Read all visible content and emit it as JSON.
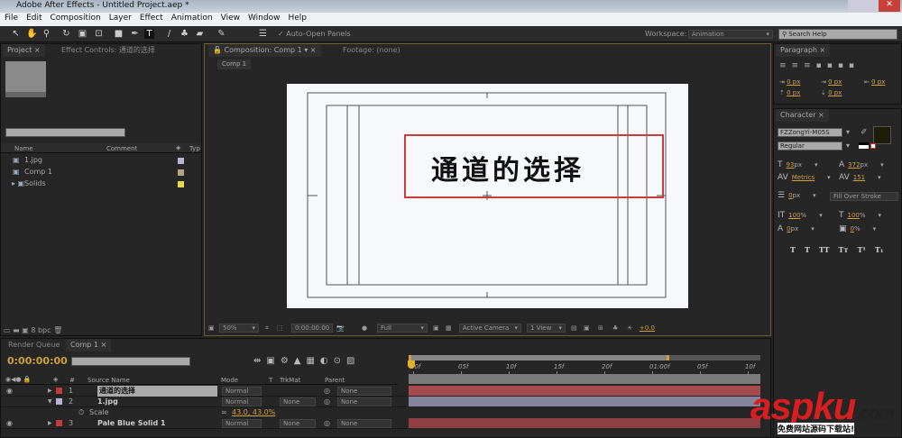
{
  "window": {
    "title": "Adobe After Effects - Untitled Project.aep *"
  },
  "menu": [
    "File",
    "Edit",
    "Composition",
    "Layer",
    "Effect",
    "Animation",
    "View",
    "Window",
    "Help"
  ],
  "toolbar": {
    "auto_open": "Auto-Open Panels",
    "workspace_label": "Workspace:",
    "workspace": "Animation",
    "search_placeholder": "Search Help"
  },
  "project": {
    "tab": "Project",
    "effect_tab": "Effect Controls: 通道的选择",
    "columns": [
      "Name",
      "Comment",
      "Typ"
    ],
    "items": [
      {
        "name": "1.jpg",
        "color": "#b9b3d9"
      },
      {
        "name": "Comp 1",
        "color": "#b6a483"
      },
      {
        "name": "Solids",
        "color": "#e6d94e"
      }
    ],
    "bpc": "8 bpc"
  },
  "comp": {
    "tab": "Composition: Comp 1",
    "footage_tab": "Footage: (none)",
    "breadcrumb": "Comp 1",
    "text": "通道的选择",
    "footer": {
      "zoom": "50%",
      "time": "0:00:00:00",
      "resolution": "Full",
      "camera": "Active Camera",
      "views": "1 View",
      "exposure": "+0.0"
    }
  },
  "paragraph": {
    "tab": "Paragraph",
    "values": [
      "0 px",
      "0 px",
      "0 px",
      "0 px",
      "0 px"
    ]
  },
  "character": {
    "tab": "Character",
    "font": "FZZongYi-M05S",
    "style": "Regular",
    "size": "93",
    "size_unit": "px",
    "leading": "372",
    "leading_unit": "px",
    "kerning": "Metrics",
    "tracking": "151",
    "stroke": "0",
    "stroke_unit": "px",
    "stroke_mode": "Fill Over Stroke",
    "vscale": "100",
    "hscale": "100",
    "baseline": "0",
    "baseline_unit": "px",
    "tsume": "0",
    "pct": "%",
    "fill_color": "#1f1c0a",
    "styles": [
      "T",
      "T",
      "TT",
      "Tт",
      "T¹",
      "T₁"
    ]
  },
  "timeline": {
    "render_tab": "Render Queue",
    "comp_tab": "Comp 1",
    "time": "0:00:00:00",
    "columns": {
      "num": "#",
      "source": "Source Name",
      "mode": "Mode",
      "t": "T",
      "trkmat": "TrkMat",
      "parent": "Parent"
    },
    "layers": [
      {
        "num": "1",
        "name": "通道的选择",
        "mode": "Normal",
        "trkmat": "",
        "parent": "None",
        "label": "#c43a3a",
        "bar": "#a64a4e"
      },
      {
        "num": "2",
        "name": "1.jpg",
        "mode": "Normal",
        "trkmat": "None",
        "parent": "None",
        "label": "#b9b3d9",
        "bar": "#86839c"
      },
      {
        "num": "3",
        "name": "Pale Blue Solid 1",
        "mode": "Normal",
        "trkmat": "None",
        "parent": "None",
        "label": "#c43a3a",
        "bar": "#8e3f42"
      }
    ],
    "scale_label": "Scale",
    "scale_value": "43.0, 43.0%",
    "ruler": [
      "00f",
      "05f",
      "10f",
      "15f",
      "20f",
      "01:00f",
      "05f",
      "10f"
    ]
  },
  "watermark": {
    "logo": "aspku.com",
    "sub": "免费网站源码下载站!"
  }
}
